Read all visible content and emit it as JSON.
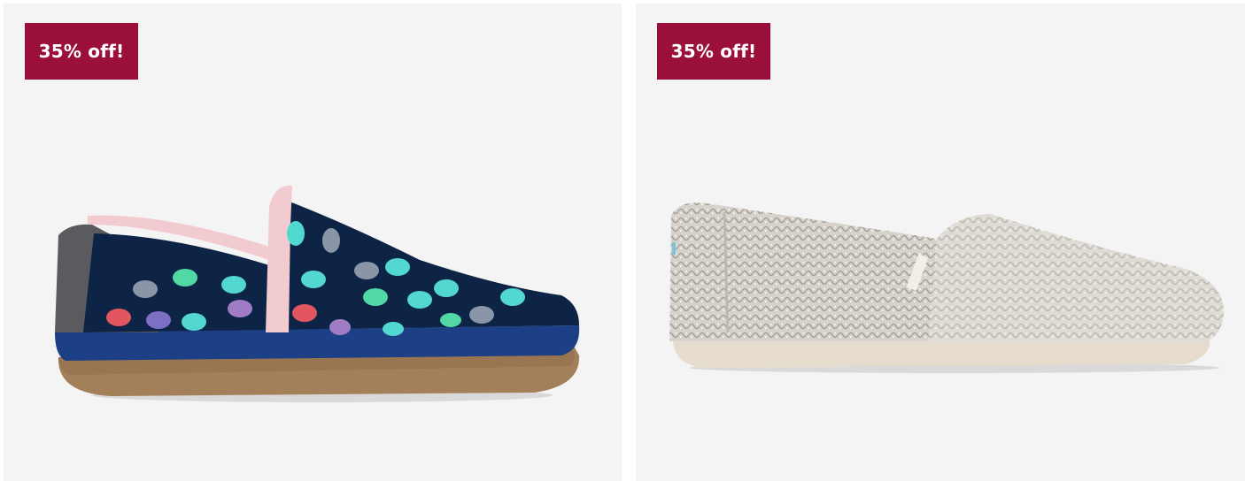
{
  "products": [
    {
      "badge": "35% off!",
      "image_desc": "navy-holiday-lights-slipper"
    },
    {
      "badge": "35% off!",
      "image_desc": "grey-knit-alpargata"
    }
  ],
  "colors": {
    "badge_bg": "#9b0f3b",
    "card_bg": "#f4f4f4"
  }
}
